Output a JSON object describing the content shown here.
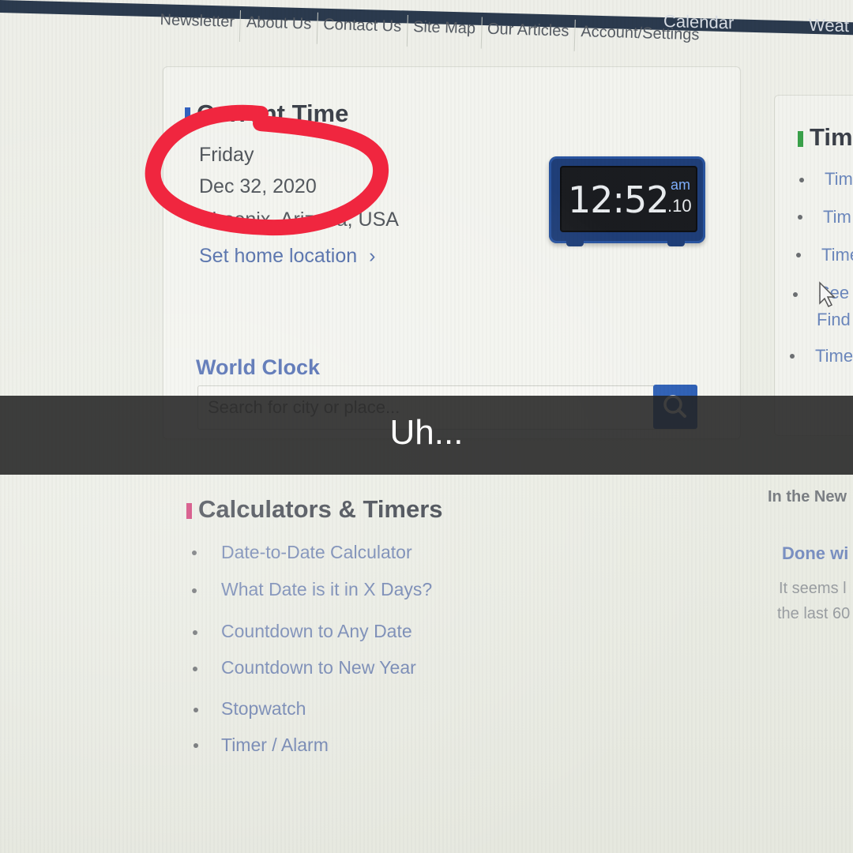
{
  "topbar": {
    "calendar_label": "Calendar",
    "weather_label": "Weat"
  },
  "subnav": [
    "Newsletter",
    "About Us",
    "Contact Us",
    "Site Map",
    "Our Articles",
    "Account/Settings"
  ],
  "current_time": {
    "title": "Current Time",
    "day": "Friday",
    "date": "Dec 32, 2020",
    "location": "Phoenix, Arizona, USA",
    "home_link": "Set home location",
    "home_link_chevron": "›"
  },
  "clock": {
    "time": "12:52",
    "ampm": "am",
    "seconds": ".10"
  },
  "world_clock": {
    "title": "World Clock",
    "search_placeholder": "Search for city or place..."
  },
  "right_card": {
    "title": "Tim",
    "items": [
      "Tim",
      "Tim",
      "Time",
      "See",
      "Find",
      "Time"
    ]
  },
  "calculators": {
    "title": "Calculators & Timers",
    "items": [
      "Date-to-Date Calculator",
      "What Date is it in X Days?",
      "Countdown to Any Date",
      "Countdown to New Year",
      "Stopwatch",
      "Timer / Alarm"
    ]
  },
  "news": {
    "heading": "In the New",
    "item_title": "Done wi",
    "item_text_1": "It seems l",
    "item_text_2": "the last 60"
  },
  "overlay": {
    "caption": "Uh..."
  },
  "colors": {
    "annotation": "#f0263f",
    "accent_blue": "#2d5fb5",
    "section_blue": "#2f5fbf",
    "section_green": "#3aa24a",
    "section_pink": "#d0336f"
  }
}
